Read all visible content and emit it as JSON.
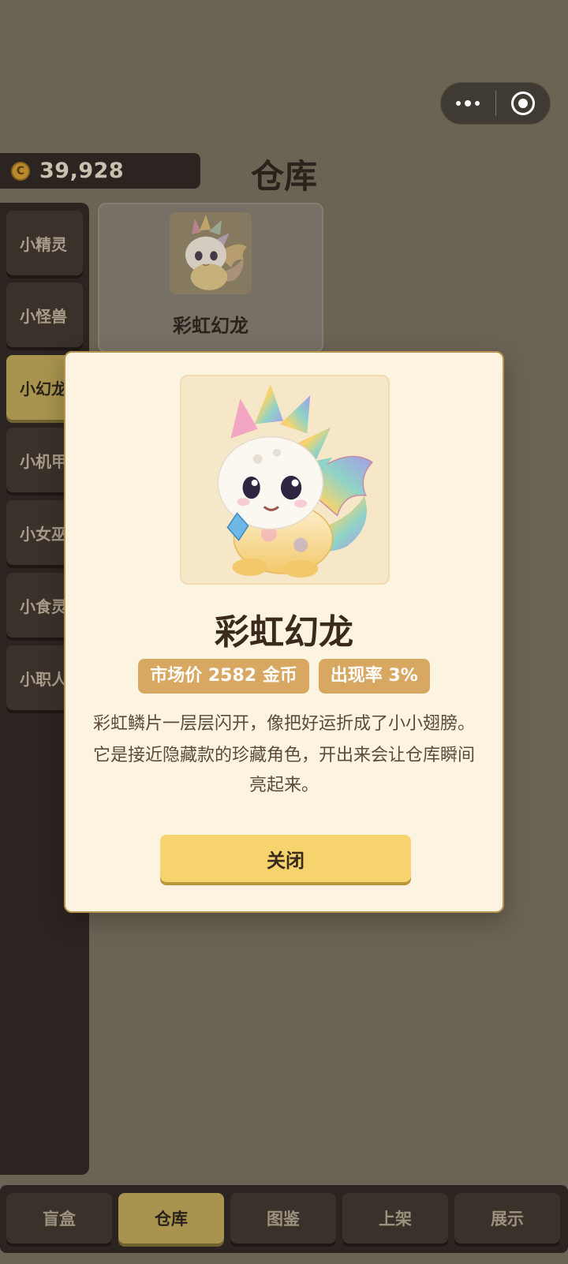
{
  "header": {
    "coins": "39,928",
    "coin_icon": "coin-icon",
    "title": "仓库"
  },
  "capsule": {
    "more_icon": "more-dots-icon",
    "close_icon": "target-icon"
  },
  "sidebar": {
    "items": [
      {
        "label": "小精灵",
        "active": false
      },
      {
        "label": "小怪兽",
        "active": false
      },
      {
        "label": "小幻龙",
        "active": true
      },
      {
        "label": "小机甲",
        "active": false
      },
      {
        "label": "小女巫",
        "active": false
      },
      {
        "label": "小食灵",
        "active": false
      },
      {
        "label": "小职人",
        "active": false
      }
    ]
  },
  "grid": {
    "cards": [
      {
        "name": "彩虹幻龙",
        "image": "rainbow-dragon-image"
      }
    ]
  },
  "modal": {
    "name": "彩虹幻龙",
    "image": "rainbow-dragon-image",
    "price_badge": "市场价 2582 金币",
    "rate_badge": "出现率 3%",
    "description": [
      "彩虹鳞片一层层闪开，像把好运折成了小小翅膀。",
      "它是接近隐藏款的珍藏角色，开出来会让仓库瞬间亮起来。"
    ],
    "close_label": "关闭"
  },
  "bottom_nav": {
    "items": [
      {
        "label": "盲盒",
        "active": false
      },
      {
        "label": "仓库",
        "active": true
      },
      {
        "label": "图鉴",
        "active": false
      },
      {
        "label": "上架",
        "active": false
      },
      {
        "label": "展示",
        "active": false
      }
    ]
  },
  "colors": {
    "backdrop": "#6b6354",
    "panel_dark": "#2c2420",
    "active_gold": "#a8944e",
    "modal_bg": "#fcf4e1",
    "badge": "#d8a863",
    "close_button": "#f6d36d"
  }
}
